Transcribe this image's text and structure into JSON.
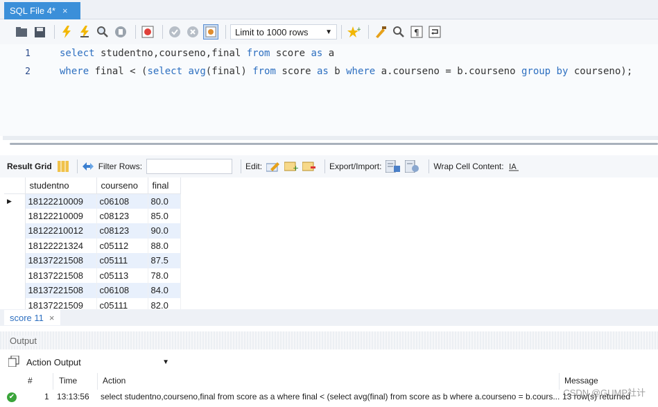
{
  "tab": {
    "title": "SQL File 4*",
    "close": "×"
  },
  "toolbar": {
    "icons": [
      "open-folder-icon",
      "save-icon",
      "execute-icon",
      "execute-current-icon",
      "explain-icon",
      "stop-icon",
      "toggle-error-icon",
      "commit-icon",
      "rollback-icon",
      "autocommit-icon",
      "star-icon",
      "beautify-icon",
      "find-icon",
      "invisible-chars-icon",
      "wrap-icon"
    ],
    "limit_label": "Limit to 1000 rows"
  },
  "editor": {
    "lines": [
      {
        "num": "1",
        "tokens": [
          {
            "t": "select",
            "kw": true
          },
          {
            "t": " studentno,courseno,final ",
            "kw": false
          },
          {
            "t": "from",
            "kw": true
          },
          {
            "t": " score ",
            "kw": false
          },
          {
            "t": "as",
            "kw": true
          },
          {
            "t": " a",
            "kw": false
          }
        ]
      },
      {
        "num": "2",
        "tokens": [
          {
            "t": "where",
            "kw": true
          },
          {
            "t": " final < (",
            "kw": false
          },
          {
            "t": "select",
            "kw": true
          },
          {
            "t": " ",
            "kw": false
          },
          {
            "t": "avg",
            "kw": true
          },
          {
            "t": "(final) ",
            "kw": false
          },
          {
            "t": "from",
            "kw": true
          },
          {
            "t": " score ",
            "kw": false
          },
          {
            "t": "as",
            "kw": true
          },
          {
            "t": " b ",
            "kw": false
          },
          {
            "t": "where",
            "kw": true
          },
          {
            "t": " a.courseno = b.courseno ",
            "kw": false
          },
          {
            "t": "group by",
            "kw": true
          },
          {
            "t": " courseno);",
            "kw": false
          }
        ]
      }
    ]
  },
  "result_toolbar": {
    "result_grid": "Result Grid",
    "filter_rows": "Filter Rows:",
    "edit": "Edit:",
    "export_import": "Export/Import:",
    "wrap": "Wrap Cell Content:"
  },
  "grid": {
    "columns": [
      "studentno",
      "courseno",
      "final"
    ],
    "rows": [
      [
        "18122210009",
        "c06108",
        "80.0"
      ],
      [
        "18122210009",
        "c08123",
        "85.0"
      ],
      [
        "18122210012",
        "c08123",
        "90.0"
      ],
      [
        "18122221324",
        "c05112",
        "88.0"
      ],
      [
        "18137221508",
        "c05111",
        "87.5"
      ],
      [
        "18137221508",
        "c05113",
        "78.0"
      ],
      [
        "18137221508",
        "c06108",
        "84.0"
      ],
      [
        "18137221509",
        "c05111",
        "82.0"
      ]
    ]
  },
  "result_tab": {
    "label": "score 11",
    "close": "×"
  },
  "output": {
    "header": "Output",
    "selector": "Action Output",
    "columns": {
      "num": "#",
      "time": "Time",
      "action": "Action",
      "message": "Message"
    },
    "row": {
      "num": "1",
      "time": "13:13:56",
      "action": "select studentno,courseno,final from score as a  where final < (select avg(final) from score as b where a.courseno = b.cours...",
      "message": "13 row(s) returned"
    }
  },
  "watermark": "CSDN @GUMP社计"
}
